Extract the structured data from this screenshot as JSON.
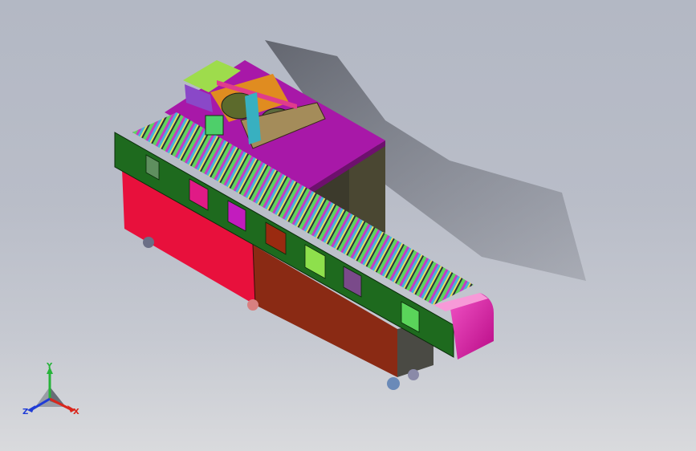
{
  "viewport": {
    "background_top": "#b3b8c4",
    "background_bottom": "#d9dadd"
  },
  "triad": {
    "x_label": "X",
    "y_label": "Y",
    "z_label": "Z",
    "x_color": "#d9261c",
    "y_color": "#27b33a",
    "z_color": "#1f3bd6"
  },
  "model": {
    "cabinet_left_color": "#e8103c",
    "cabinet_right_color": "#8a2a14",
    "top_plate_color": "#a818a8",
    "side_frame_color": "#1e6a1e",
    "end_cap_color": "#e21aa8",
    "rear_housing_color": "#3c3a2c"
  }
}
